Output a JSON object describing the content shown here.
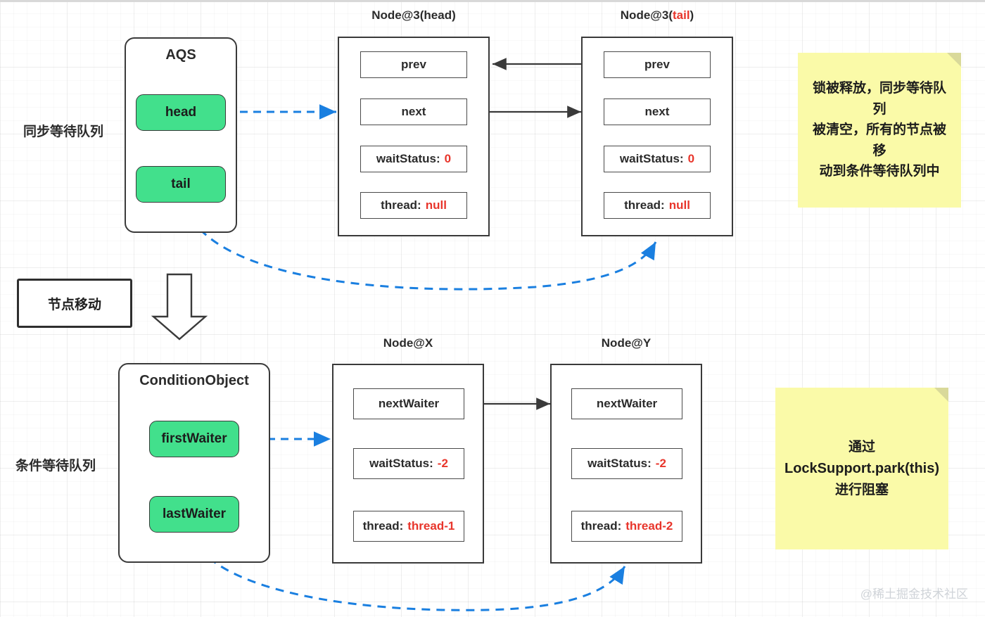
{
  "diagram": {
    "title_watermark": "@稀土掘金技术社区",
    "side_labels": {
      "sync_queue": "同步等待队列",
      "condition_queue": "条件等待队列"
    },
    "move_box": "节点移动",
    "aqs": {
      "title": "AQS",
      "fields": [
        "head",
        "tail"
      ]
    },
    "condition_object": {
      "title": "ConditionObject",
      "fields": [
        "firstWaiter",
        "lastWaiter"
      ]
    },
    "sync_nodes": [
      {
        "label_prefix": "Node@3(",
        "label_accent": "head",
        "label_suffix": ")",
        "accent_is_red": false,
        "cells": [
          {
            "key": "prev",
            "value": ""
          },
          {
            "key": "next",
            "value": ""
          },
          {
            "key": "waitStatus:",
            "value": "0"
          },
          {
            "key": "thread:",
            "value": "null"
          }
        ]
      },
      {
        "label_prefix": "Node@3(",
        "label_accent": "tail",
        "label_suffix": ")",
        "accent_is_red": true,
        "cells": [
          {
            "key": "prev",
            "value": ""
          },
          {
            "key": "next",
            "value": ""
          },
          {
            "key": "waitStatus:",
            "value": "0"
          },
          {
            "key": "thread:",
            "value": "null"
          }
        ]
      }
    ],
    "condition_nodes": [
      {
        "label": "Node@X",
        "cells": [
          {
            "key": "nextWaiter",
            "value": ""
          },
          {
            "key": "waitStatus:",
            "value": "-2"
          },
          {
            "key": "thread:",
            "value": "thread-1"
          }
        ]
      },
      {
        "label": "Node@Y",
        "cells": [
          {
            "key": "nextWaiter",
            "value": ""
          },
          {
            "key": "waitStatus:",
            "value": "-2"
          },
          {
            "key": "thread:",
            "value": "thread-2"
          }
        ]
      }
    ],
    "notes": [
      {
        "lines": [
          "锁被释放，同步等待队列",
          "被清空，所有的节点被移",
          "动到条件等待队列中"
        ]
      },
      {
        "lines": [
          "通过",
          "LockSupport.park(this)",
          "进行阻塞"
        ]
      }
    ],
    "colors": {
      "accent_green": "#42e08c",
      "sticky_yellow": "#fafaa8",
      "red_value": "#e8352b",
      "blue_arrow": "#1a7fe0",
      "stroke": "#3a3a3a"
    }
  }
}
